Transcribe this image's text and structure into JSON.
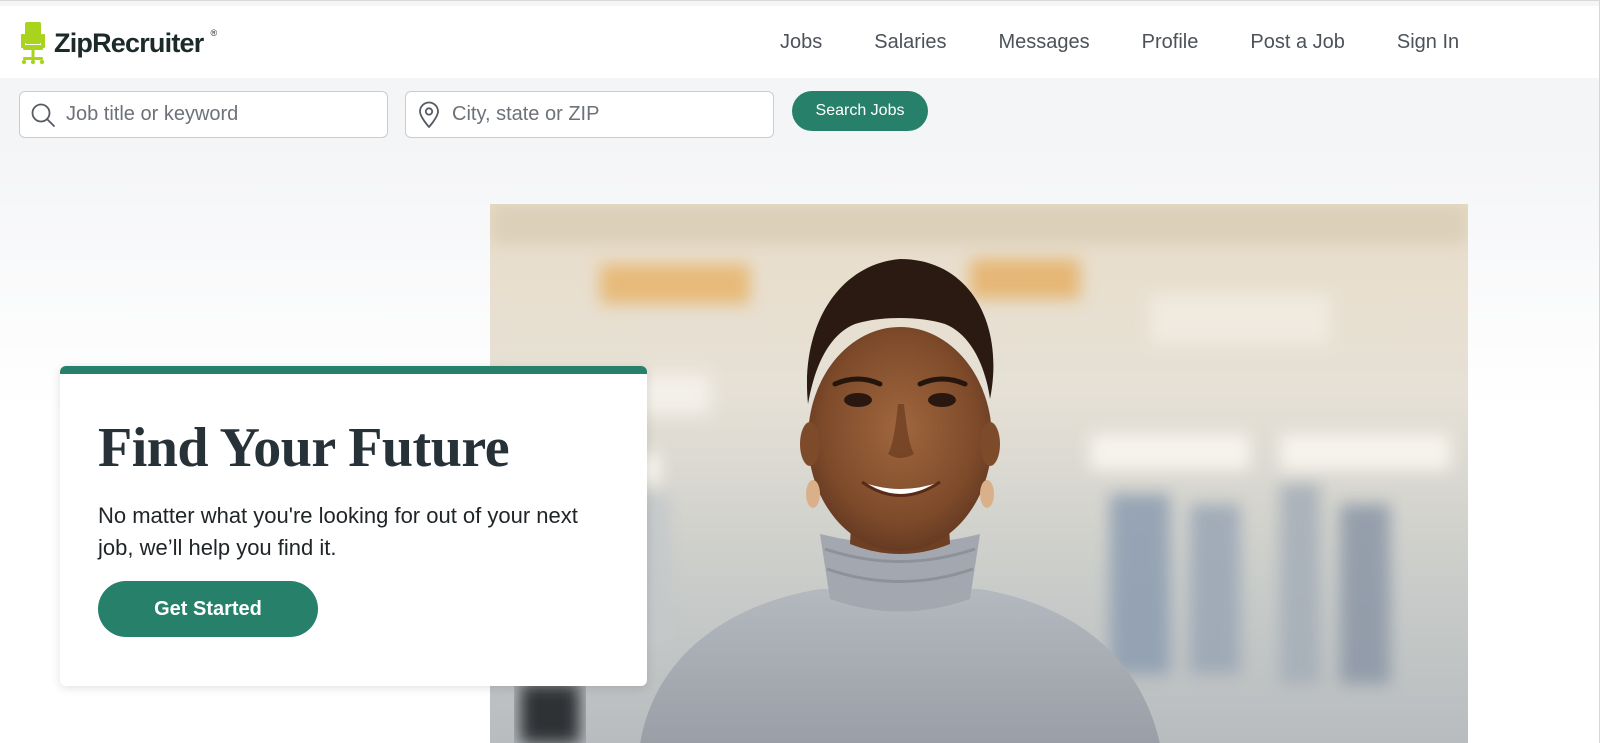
{
  "brand": {
    "name": "ZipRecruiter",
    "registered": "®",
    "accent": "#27806a",
    "logo_color": "#a8d41e"
  },
  "nav": {
    "items": [
      "Jobs",
      "Salaries",
      "Messages",
      "Profile",
      "Post a Job",
      "Sign In"
    ]
  },
  "search": {
    "keyword_placeholder": "Job title or keyword",
    "keyword_value": "",
    "location_placeholder": "City, state or ZIP",
    "location_value": "",
    "button_label": "Search Jobs",
    "keyword_icon": "search-icon",
    "location_icon": "location-pin-icon"
  },
  "hero": {
    "title": "Find Your Future",
    "subtitle": "No matter what you're looking for out of your next job, we’ll help you find it.",
    "cta_label": "Get Started"
  }
}
